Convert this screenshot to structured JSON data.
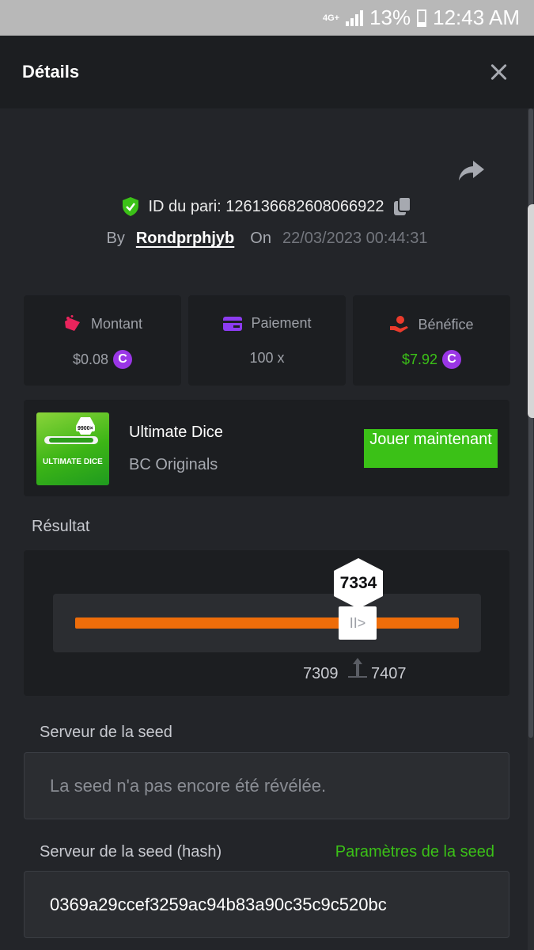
{
  "status_bar": {
    "network": "4G+",
    "battery": "13%",
    "time": "12:43 AM"
  },
  "header": {
    "title": "Détails"
  },
  "bet": {
    "id_label": "ID du pari: 126136682608066922",
    "by_label": "By",
    "username": "Rondprphjyb",
    "on_label": "On",
    "datetime": "22/03/2023 00:44:31"
  },
  "stats": {
    "montant": {
      "label": "Montant",
      "value": "$0.08"
    },
    "paiement": {
      "label": "Paiement",
      "value": "100 x"
    },
    "benefice": {
      "label": "Bénéfice",
      "value": "$7.92"
    },
    "coin_symbol": "C"
  },
  "game": {
    "thumb_text": "ULTIMATE DICE",
    "thumb_multiplier": "9900×",
    "name": "Ultimate Dice",
    "provider": "BC Originals",
    "play_label": "Jouer maintenant"
  },
  "result": {
    "label": "Résultat",
    "value": "7334",
    "range_min": "7309",
    "range_max": "7407",
    "handle_glyph": "II>"
  },
  "seed": {
    "server_label": "Serveur de la seed",
    "server_value": "La seed n'a pas encore été révélée.",
    "hash_label": "Serveur de la seed (hash)",
    "settings_link": "Paramètres de la seed",
    "hash_value": "0369a29ccef3259ac94b83a90c35c9c520bc"
  },
  "colors": {
    "accent_green": "#3bc117",
    "progress_orange": "#ee6d0a",
    "coin_purple": "#9a36e6",
    "background": "#232529",
    "panel": "#1c1e21"
  }
}
